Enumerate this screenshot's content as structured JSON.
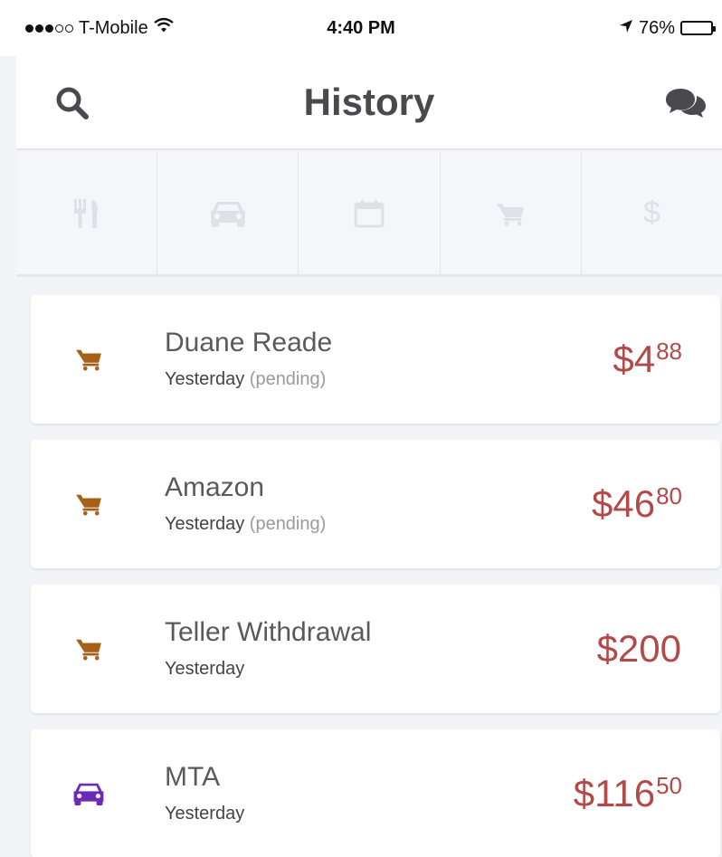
{
  "status_bar": {
    "carrier": "T-Mobile",
    "time": "4:40 PM",
    "battery": "76%",
    "battery_level": 0.76
  },
  "header": {
    "title": "History",
    "search_icon": "search-icon",
    "chat_icon": "chat-icon"
  },
  "tabs": [
    {
      "icon": "restaurant-icon"
    },
    {
      "icon": "car-icon"
    },
    {
      "icon": "calendar-icon"
    },
    {
      "icon": "shopping-cart-icon"
    },
    {
      "icon": "dollar-icon",
      "glyph": "$"
    }
  ],
  "transactions": [
    {
      "icon": "shopping-cart-icon",
      "name": "Duane Reade",
      "date": "Yesterday",
      "status": "(pending)",
      "amount": "$4",
      "cents": "88"
    },
    {
      "icon": "shopping-cart-icon",
      "name": "Amazon",
      "date": "Yesterday",
      "status": "(pending)",
      "amount": "$46",
      "cents": "80"
    },
    {
      "icon": "shopping-cart-icon",
      "name": "Teller Withdrawal",
      "date": "Yesterday",
      "status": "",
      "amount": "$200",
      "cents": ""
    },
    {
      "icon": "car-icon",
      "name": "MTA",
      "date": "Yesterday",
      "status": "",
      "amount": "$116",
      "cents": "50"
    }
  ],
  "colors": {
    "cart_icon": "#a5611a",
    "car_icon": "#6b2bb8",
    "amount": "#b24a4a",
    "tab_icon": "#dfe1e6",
    "header_text": "#4a4a4e"
  }
}
